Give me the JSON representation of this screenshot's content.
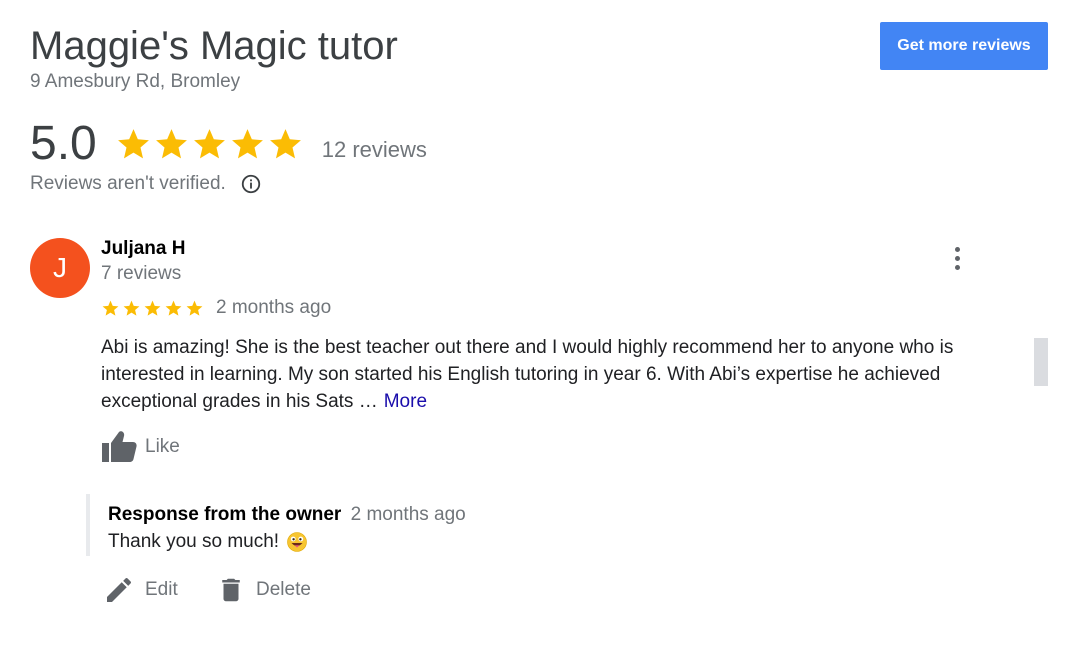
{
  "business": {
    "name": "Maggie's Magic tutor",
    "address": "9 Amesbury Rd, Bromley"
  },
  "actions": {
    "get_more_reviews": "Get more reviews"
  },
  "summary": {
    "rating": "5.0",
    "stars": 5,
    "review_count": "12 reviews",
    "verification_note": "Reviews aren't verified."
  },
  "review": {
    "avatar_initial": "J",
    "reviewer_name": "Juljana H",
    "reviewer_reviews": "7 reviews",
    "stars": 5,
    "date": "2 months ago",
    "text_lines": [
      "Abi is amazing! She is the best teacher out there and I would highly recommend her to anyone who is",
      "interested in learning. My son started his English tutoring in year 6. With Abi’s expertise he achieved",
      "exceptional grades in his Sats …"
    ],
    "more_label": "More",
    "like_label": "Like"
  },
  "owner_response": {
    "label": "Response from the owner",
    "date": "2 months ago",
    "text": "Thank you so much!"
  },
  "owner_actions": {
    "edit_label": "Edit",
    "delete_label": "Delete"
  },
  "colors": {
    "star": "#fbbc04",
    "button": "#4285f4",
    "avatar": "#f4511e",
    "link": "#1a0dab",
    "muted": "#70757a"
  },
  "icons": {
    "info": "info-circle-icon",
    "menu": "more-vert-icon",
    "like": "thumbs-up-icon",
    "edit": "pencil-icon",
    "delete": "trash-icon",
    "emoji": "grinning-tongue-emoji"
  }
}
